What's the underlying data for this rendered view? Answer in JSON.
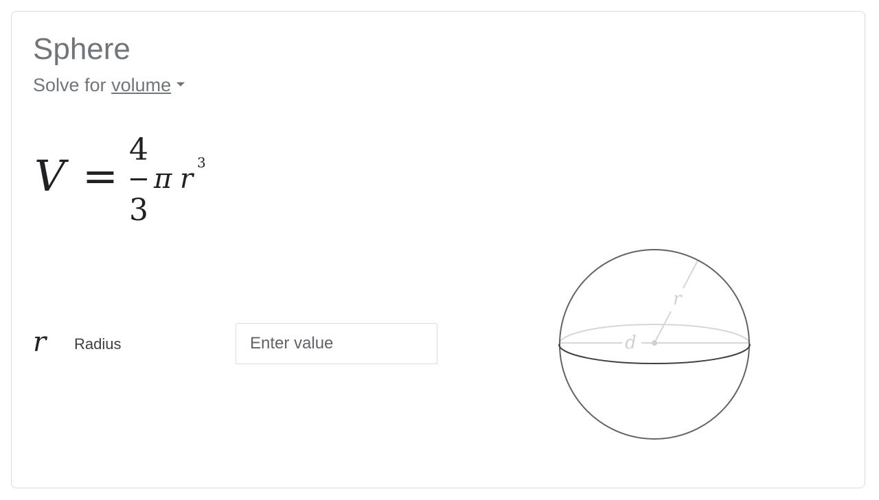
{
  "card": {
    "title": "Sphere",
    "solve_prefix": "Solve for",
    "solve_target": "volume"
  },
  "formula": {
    "lhs": "V",
    "equals": "=",
    "numerator": "4",
    "denominator": "3",
    "pi": "π",
    "variable": "r",
    "exponent": "3"
  },
  "inputs": [
    {
      "symbol": "r",
      "label": "Radius",
      "value": "",
      "placeholder": "Enter value"
    }
  ],
  "diagram": {
    "radius_label": "r",
    "diameter_label": "d",
    "outline_color": "#5f6368",
    "annotation_color": "#d0d0d0"
  }
}
